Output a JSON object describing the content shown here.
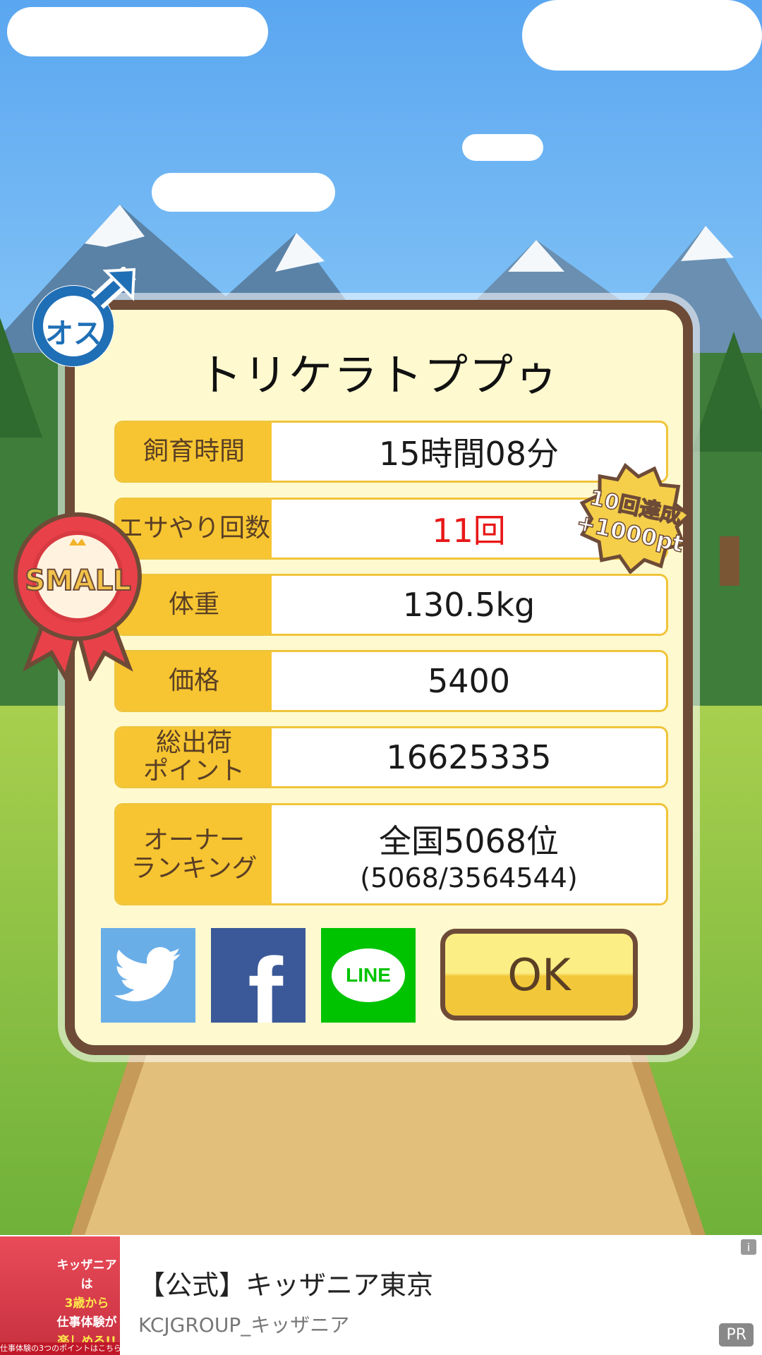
{
  "pet": {
    "gender_badge": "オス",
    "name": "トリケラトププゥ",
    "size_ribbon": "SMALL"
  },
  "stats": {
    "time_label": "飼育時間",
    "time_value": "15時間08分",
    "feed_label": "エサやり回数",
    "feed_value": "11回",
    "weight_label": "体重",
    "weight_value": "130.5kg",
    "price_label": "価格",
    "price_value": "5400",
    "points_label_line1": "総出荷",
    "points_label_line2": "ポイント",
    "points_value": "16625335",
    "ranking_label_line1": "オーナー",
    "ranking_label_line2": "ランキング",
    "ranking_value": "全国5068位",
    "ranking_detail": "(5068/3564544)"
  },
  "achievement_badge": {
    "line1": "10回達成",
    "line2": "+1000pt"
  },
  "buttons": {
    "twitter_icon": "twitter-bird-icon",
    "facebook_text": "f",
    "line_text": "LINE",
    "ok_label": "OK"
  },
  "ad": {
    "title": "【公式】キッザニア東京",
    "sponsor": "KCJGROUP_キッザニア",
    "info_icon": "i",
    "pr_label": "PR",
    "thumb_lines": [
      "キッザニアは",
      "3歳から",
      "仕事体験が",
      "楽しめる!!"
    ],
    "thumb_footer": "仕事体験の3つのポイントはこちら ▶"
  },
  "colors": {
    "panel_bg": "#fef9cf",
    "panel_border": "#6e4b37",
    "label_bg": "#f7c531",
    "highlight": "#e81818",
    "twitter": "#6aaee8",
    "facebook": "#3b5998",
    "line": "#00c300"
  }
}
